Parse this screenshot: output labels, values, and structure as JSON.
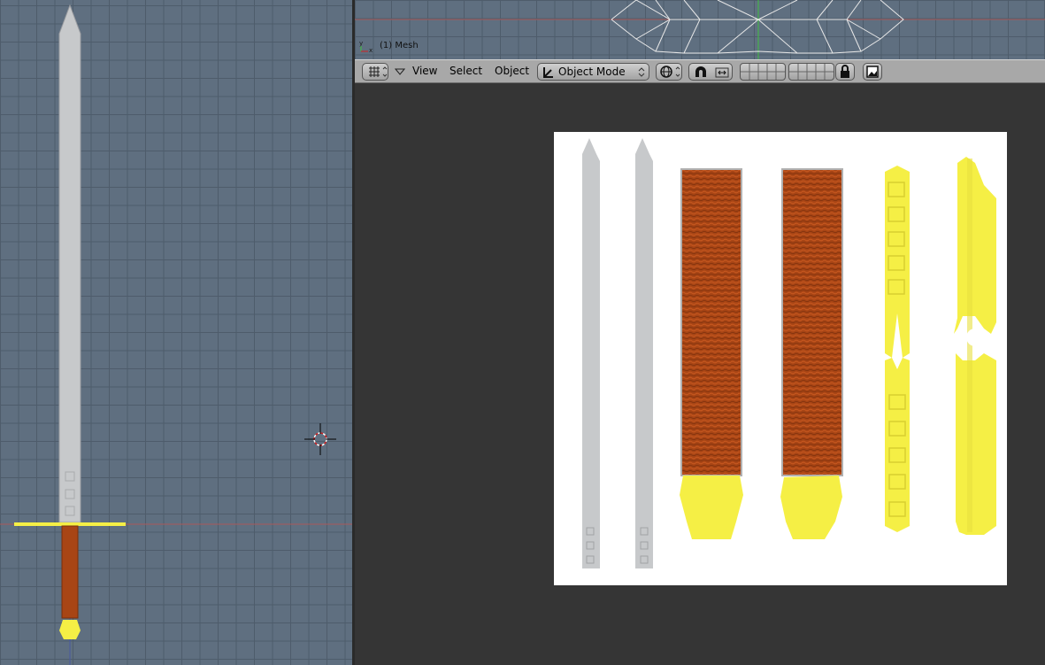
{
  "viewport_top": {
    "object_label": "(1) Mesh"
  },
  "header": {
    "menus": [
      {
        "label": "View"
      },
      {
        "label": "Select"
      },
      {
        "label": "Object"
      }
    ],
    "mode_selector": {
      "label": "Object Mode"
    },
    "icons": [
      "editor-type-grid-icon",
      "menu-triangle-icon",
      "mode-cursor-icon",
      "draw-type-sphere-icon",
      "magnet-icon",
      "pivot-icon",
      "layers-grid-icon",
      "lock-icon",
      "render-image-icon"
    ]
  },
  "colors": {
    "grid_bg": "#5f6f80",
    "blade": "#c7c9cb",
    "gold": "#f5ef45",
    "leather": "#a84515",
    "uv_bg": "#353535",
    "header": "#a8a8a8"
  }
}
